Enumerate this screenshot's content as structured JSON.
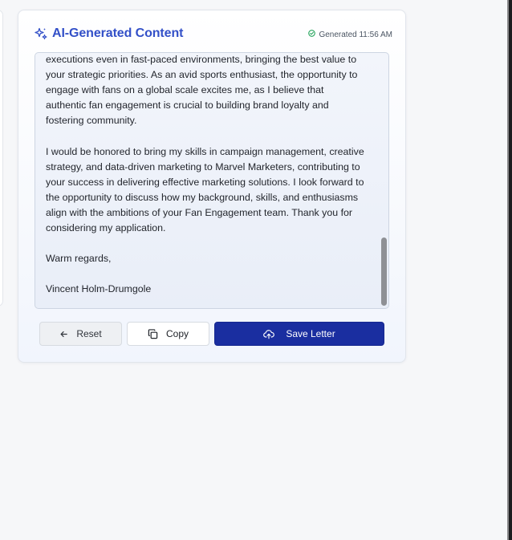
{
  "card": {
    "title": "AI-Generated Content",
    "generated_text": "Generated 11:56 AM"
  },
  "letter": {
    "paragraphs": [
      "executions even in fast-paced environments, bringing the best value to your strategic priorities. As an avid sports enthusiast, the opportunity to engage with fans on a global scale excites me, as I believe that authentic fan engagement is crucial to building brand loyalty and fostering community.",
      "I would be honored to bring my skills in campaign management, creative strategy, and data-driven marketing to Marvel Marketers, contributing to your success in delivering effective marketing solutions. I look forward to the opportunity to discuss how my background, skills, and enthusiasms align with the ambitions of your Fan Engagement team. Thank you for considering my application.",
      "Warm regards,",
      "Vincent Holm-Drumgole"
    ]
  },
  "actions": {
    "reset_label": "Reset",
    "copy_label": "Copy",
    "save_label": "Save Letter"
  },
  "icons": {
    "title_icon": "sparkles-icon",
    "status_icon": "check-circle-icon",
    "reset_icon": "arrow-left-icon",
    "copy_icon": "copy-icon",
    "save_icon": "cloud-upload-icon"
  },
  "colors": {
    "accent": "#3350c8",
    "primary_button": "#1a2ea0",
    "success": "#22a35a"
  }
}
